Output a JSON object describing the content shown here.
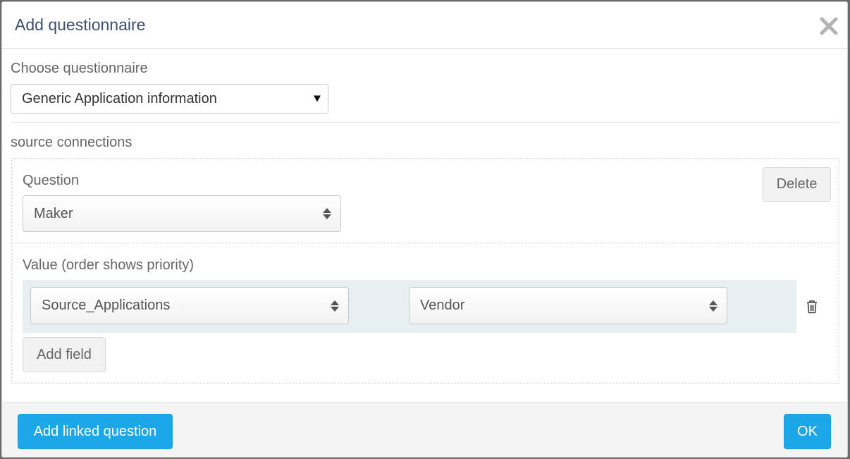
{
  "dialog": {
    "title": "Add questionnaire",
    "close_icon": "close-icon"
  },
  "choose": {
    "label": "Choose questionnaire",
    "selected": "Generic Application information"
  },
  "section": {
    "title": "source connections"
  },
  "question": {
    "label": "Question",
    "selected": "Maker",
    "delete_label": "Delete"
  },
  "value": {
    "label": "Value (order shows priority)",
    "fields": [
      {
        "selected": "Source_Applications"
      },
      {
        "selected": "Vendor"
      }
    ],
    "delete_icon": "trash-icon",
    "add_field_label": "Add field"
  },
  "footer": {
    "add_linked_label": "Add linked question",
    "ok_label": "OK"
  },
  "colors": {
    "primary": "#1ba7e8",
    "title": "#3e4f6e",
    "row_highlight": "#e7eff2"
  }
}
